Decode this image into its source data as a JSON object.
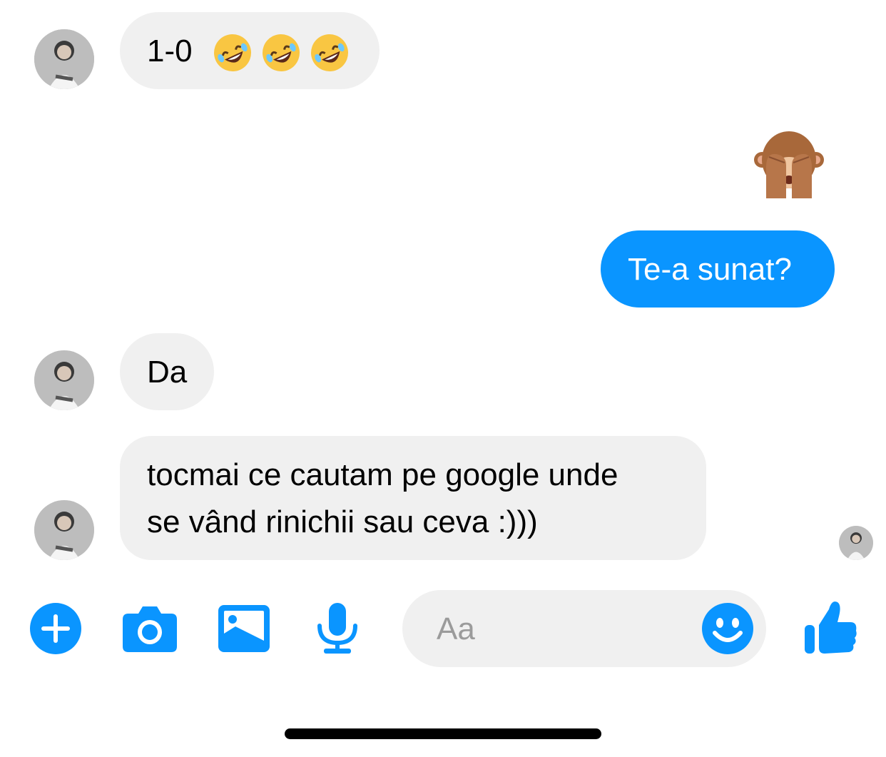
{
  "accent_color": "#0a95ff",
  "messages": [
    {
      "from": "them",
      "text": "1-0",
      "emojis": [
        "rolling-on-floor-laughing-emoji",
        "rolling-on-floor-laughing-emoji",
        "rolling-on-floor-laughing-emoji"
      ]
    },
    {
      "from": "me",
      "emoji": "see-no-evil-monkey-emoji"
    },
    {
      "from": "me",
      "text": "Te-a sunat?"
    },
    {
      "from": "them",
      "text": "Da"
    },
    {
      "from": "them",
      "lines": [
        "tocmai ce cautam pe google unde",
        "se vând rinichii sau ceva :)))"
      ]
    }
  ],
  "composer": {
    "placeholder": "Aa",
    "icons": [
      "plus-icon",
      "camera-icon",
      "image-icon",
      "microphone-icon",
      "emoji-smile-icon",
      "thumbs-up-icon"
    ]
  }
}
